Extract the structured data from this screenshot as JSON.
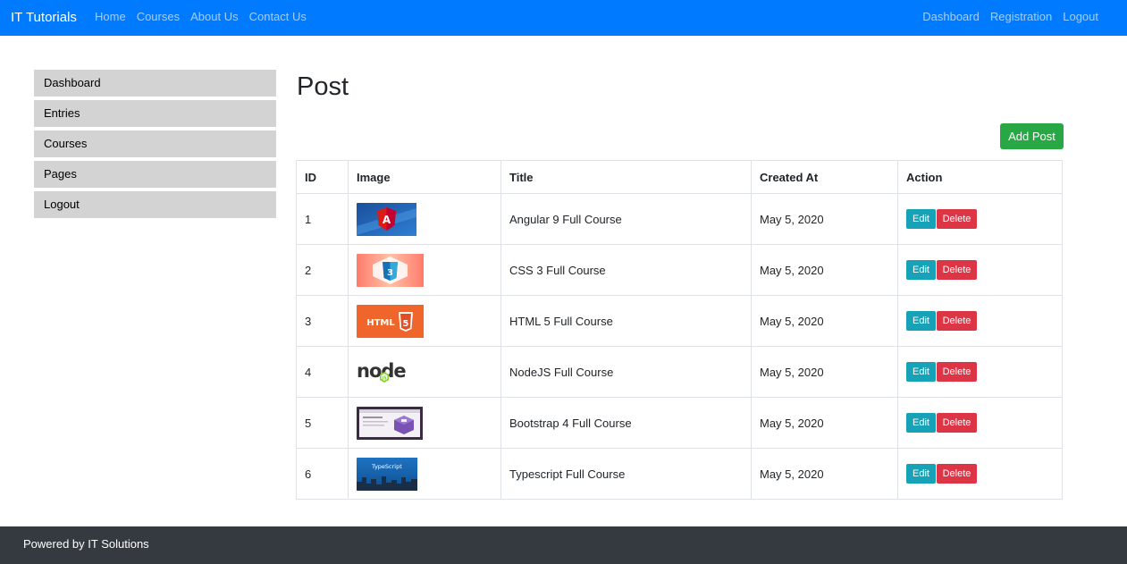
{
  "navbar": {
    "brand": "IT Tutorials",
    "left_links": [
      "Home",
      "Courses",
      "About Us",
      "Contact Us"
    ],
    "right_links": [
      "Dashboard",
      "Registration",
      "Logout"
    ],
    "color": "#007bff"
  },
  "sidebar": {
    "items": [
      {
        "label": "Dashboard"
      },
      {
        "label": "Entries"
      },
      {
        "label": "Courses"
      },
      {
        "label": "Pages"
      },
      {
        "label": "Logout"
      }
    ]
  },
  "main": {
    "title": "Post",
    "add_button": "Add Post"
  },
  "table": {
    "headers": [
      "ID",
      "Image",
      "Title",
      "Created At",
      "Action"
    ],
    "rows": [
      {
        "id": "1",
        "image_icon": "angular-thumbnail",
        "title": "Angular 9 Full Course",
        "created_at": "May 5, 2020",
        "edit_label": "Edit",
        "delete_label": "Delete"
      },
      {
        "id": "2",
        "image_icon": "css3-thumbnail",
        "title": "CSS 3 Full Course",
        "created_at": "May 5, 2020",
        "edit_label": "Edit",
        "delete_label": "Delete"
      },
      {
        "id": "3",
        "image_icon": "html5-thumbnail",
        "title": "HTML 5 Full Course",
        "created_at": "May 5, 2020",
        "edit_label": "Edit",
        "delete_label": "Delete"
      },
      {
        "id": "4",
        "image_icon": "nodejs-thumbnail",
        "title": "NodeJS Full Course",
        "created_at": "May 5, 2020",
        "edit_label": "Edit",
        "delete_label": "Delete"
      },
      {
        "id": "5",
        "image_icon": "bootstrap-thumbnail",
        "title": "Bootstrap 4 Full Course",
        "created_at": "May 5, 2020",
        "edit_label": "Edit",
        "delete_label": "Delete"
      },
      {
        "id": "6",
        "image_icon": "typescript-thumbnail",
        "title": "Typescript Full Course",
        "created_at": "May 5, 2020",
        "edit_label": "Edit",
        "delete_label": "Delete"
      }
    ],
    "thumbnail_text": {
      "html5": "HTML",
      "typescript": "TypeScript"
    }
  },
  "footer": {
    "text": "Powered by IT Solutions",
    "color": "#343a40"
  },
  "colors": {
    "add_button": "#28a745",
    "edit_button": "#17a2b8",
    "delete_button": "#dc3545",
    "sidebar_item": "#d3d3d3"
  }
}
